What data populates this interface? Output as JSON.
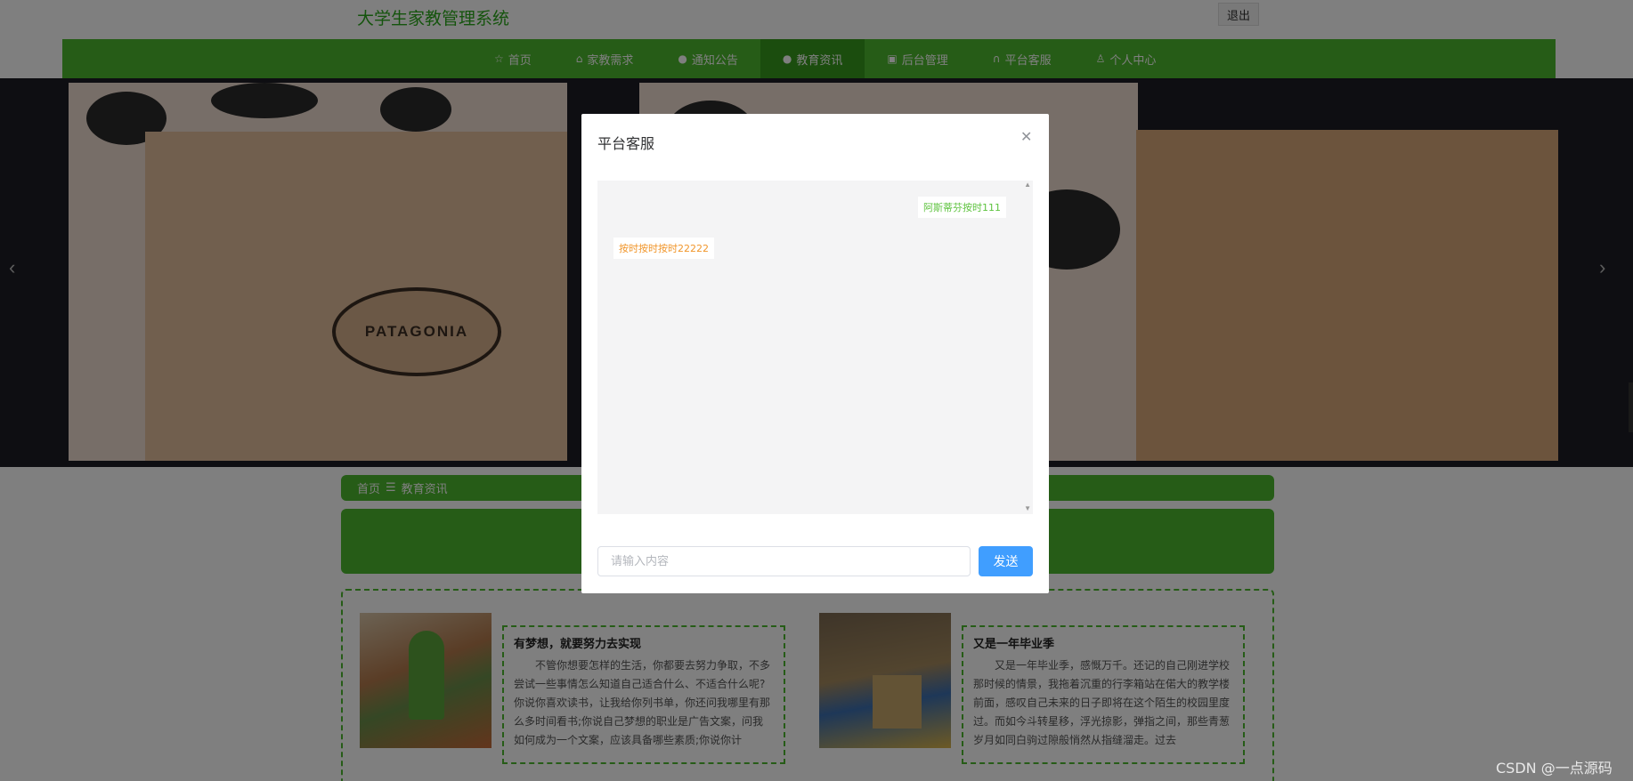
{
  "site": {
    "title": "大学生家教管理系统",
    "logout_label": "退出"
  },
  "nav": {
    "items": [
      {
        "label": "首页",
        "icon": "star-icon"
      },
      {
        "label": "家教需求",
        "icon": "bag-icon"
      },
      {
        "label": "通知公告",
        "icon": "info-icon"
      },
      {
        "label": "教育资讯",
        "icon": "info-icon"
      },
      {
        "label": "后台管理",
        "icon": "briefcase-icon"
      },
      {
        "label": "平台客服",
        "icon": "headset-icon"
      },
      {
        "label": "个人中心",
        "icon": "user-icon"
      }
    ],
    "active_index": 3
  },
  "banner": {
    "logo_text": "PATAGONIA"
  },
  "breadcrumb": {
    "home": "首页",
    "current": "教育资讯"
  },
  "articles": [
    {
      "title": "有梦想，就要努力去实现",
      "body": "不管你想要怎样的生活，你都要去努力争取，不多尝试一些事情怎么知道自己适合什么、不适合什么呢?你说你喜欢读书，让我给你列书单，你还问我哪里有那么多时间看书;你说自己梦想的职业是广告文案，问我如何成为一个文案，应该具备哪些素质;你说你计"
    },
    {
      "title": "又是一年毕业季",
      "body": "又是一年毕业季，感慨万千。还记的自己刚进学校那时候的情景，我拖着沉重的行李箱站在偌大的教学楼前面，感叹自己未来的日子即将在这个陌生的校园里度过。而如今斗转星移，浮光掠影，弹指之间，那些青葱岁月如同白驹过隙般悄然从指缝溜走。过去"
    }
  ],
  "dialog": {
    "title": "平台客服",
    "messages": [
      {
        "side": "right",
        "text": "阿斯蒂芬按时111"
      },
      {
        "side": "left",
        "text": "按时按时按时22222"
      }
    ],
    "input_placeholder": "请输入内容",
    "send_label": "发送"
  },
  "watermark": "CSDN @一点源码",
  "colors": {
    "brand_green": "#4db82e",
    "active_green": "#379a1c",
    "send_blue": "#409eff",
    "msg_right": "#5ec33f",
    "msg_left": "#f1962b"
  }
}
